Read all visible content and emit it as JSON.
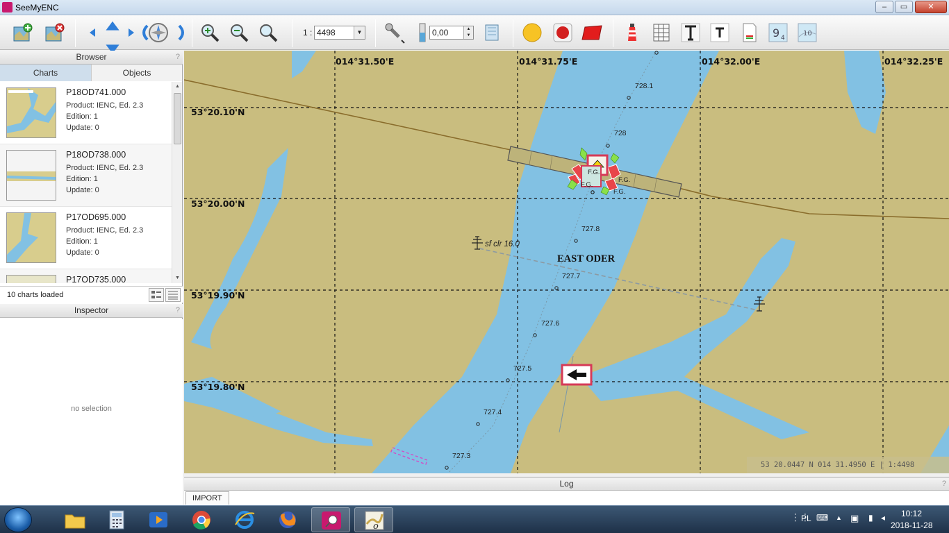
{
  "window": {
    "title": "SeeMyENC",
    "app_icon_text": "SEE MY ENC",
    "min": "–",
    "max": "▭",
    "close": "✕"
  },
  "toolbar": {
    "scale_prefix": "1 :",
    "scale_value": "4498",
    "depth_value": "0,00"
  },
  "browser": {
    "title": "Browser",
    "help": "?",
    "tabs": [
      "Charts",
      "Objects"
    ],
    "charts": [
      {
        "name": "P18OD741.000",
        "product": "Product: IENC, Ed. 2.3",
        "edition": "Edition: 1",
        "update": "Update: 0"
      },
      {
        "name": "P18OD738.000",
        "product": "Product: IENC, Ed. 2.3",
        "edition": "Edition: 1",
        "update": "Update: 0"
      },
      {
        "name": "P17OD695.000",
        "product": "Product: IENC, Ed. 2.3",
        "edition": "Edition: 1",
        "update": "Update: 0"
      },
      {
        "name": "P17OD735.000"
      }
    ],
    "status": "10 charts loaded"
  },
  "inspector": {
    "title": "Inspector",
    "help": "?",
    "empty": "no selection"
  },
  "map": {
    "lon_labels": [
      "014°31.50'E",
      "014°31.75'E",
      "014°32.00'E",
      "014°32.25'E"
    ],
    "lat_labels": [
      "53°20.10'N",
      "53°20.00'N",
      "53°19.90'N",
      "53°19.80'N"
    ],
    "km_labels": [
      "728.1",
      "728",
      "727.8",
      "727.7",
      "727.6",
      "727.5",
      "727.4",
      "727.3"
    ],
    "river_name": "EAST ODER",
    "cable_label": "sf clr 16.0",
    "light_labels": [
      "F.G.",
      "F.G.",
      "F.G.",
      "F.G."
    ],
    "coord_readout": "53 20.0447 N  014 31.4950 E | 1:4498",
    "colors": {
      "land": "#c9bd7f",
      "water": "#82c1e3",
      "grid": "#000000"
    }
  },
  "log": {
    "title": "Log",
    "help": "?",
    "tab": "IMPORT"
  },
  "taskbar": {
    "lang": "PL",
    "time": "10:12",
    "date": "2018-11-28",
    "seemyenc_label": "SEE MY ENC"
  }
}
